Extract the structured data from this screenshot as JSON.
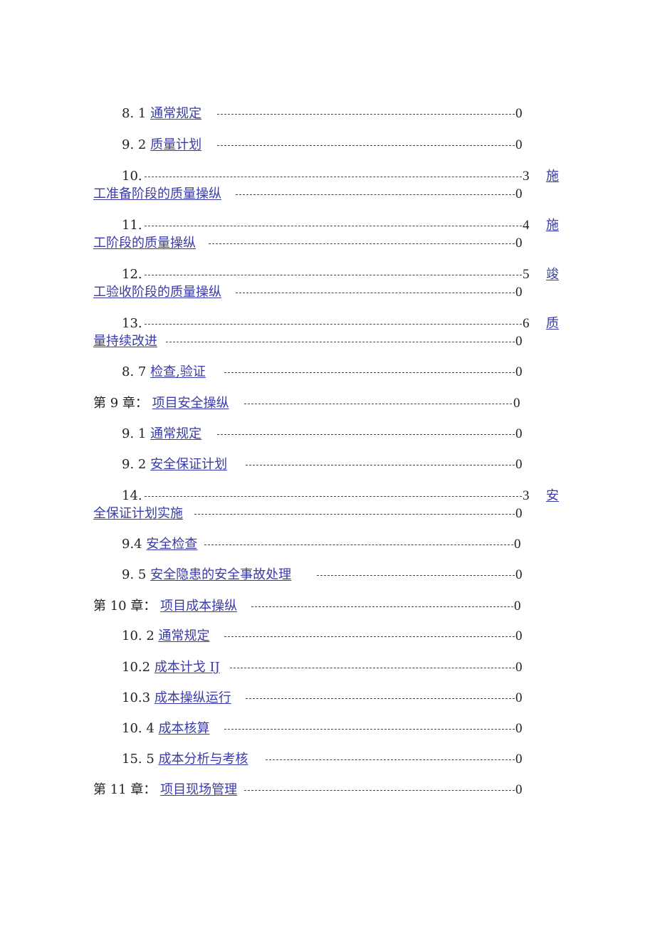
{
  "toc": {
    "entries": [
      {
        "num": "8. 1",
        "title": "通常规定",
        "page": "0"
      },
      {
        "num": "9. 2",
        "title": "质量计划",
        "page": "0"
      },
      {
        "num": "10.",
        "page": "3",
        "trail": "施",
        "cont": "工准备阶段的质量操纵",
        "cont_page": "0"
      },
      {
        "num": "11.",
        "page": "4",
        "trail": "施",
        "cont": "工阶段的质量操纵",
        "cont_page": "0"
      },
      {
        "num": "12.",
        "page": "5",
        "trail": "竣",
        "cont": "工验收阶段的质量操纵",
        "cont_page": "0"
      },
      {
        "num": "13.",
        "page": "6",
        "trail": "质",
        "cont": "量持续改进",
        "cont_page": "0"
      },
      {
        "num": "8. 7",
        "title": "检查,验证",
        "page": "0"
      },
      {
        "num": "第 9 章：",
        "title": "项目安全操纵",
        "page": "0"
      },
      {
        "num": "9. 1",
        "title": "通常规定",
        "page": "0"
      },
      {
        "num": "9. 2",
        "title": "安全保证计划",
        "page": "0"
      },
      {
        "num": "14.",
        "page": "3",
        "trail": "安",
        "cont": "全保证计划实施",
        "cont_page": "0"
      },
      {
        "num": "9.4",
        "title": "安全检查",
        "page": "0"
      },
      {
        "num": "9. 5",
        "title": "安全隐患的安全事故处理",
        "page": "0"
      },
      {
        "num": "第 10 章：",
        "title": "项目成本操纵",
        "page": "0"
      },
      {
        "num": "10. 2",
        "title": "通常规定",
        "page": "0"
      },
      {
        "num": "10.2",
        "title": "成本计戈 IJ",
        "page": "0"
      },
      {
        "num": "10.3",
        "title": "成本操纵运行",
        "page": "0"
      },
      {
        "num": "10. 4",
        "title": "成本核算",
        "page": "0"
      },
      {
        "num": "15. 5",
        "title": "成本分析与考核",
        "page": "0"
      },
      {
        "num": "第 11 章：",
        "title": "项目现场管理",
        "page": "0"
      }
    ]
  },
  "colors": {
    "link": "#3a3aa8",
    "text": "#222222"
  }
}
